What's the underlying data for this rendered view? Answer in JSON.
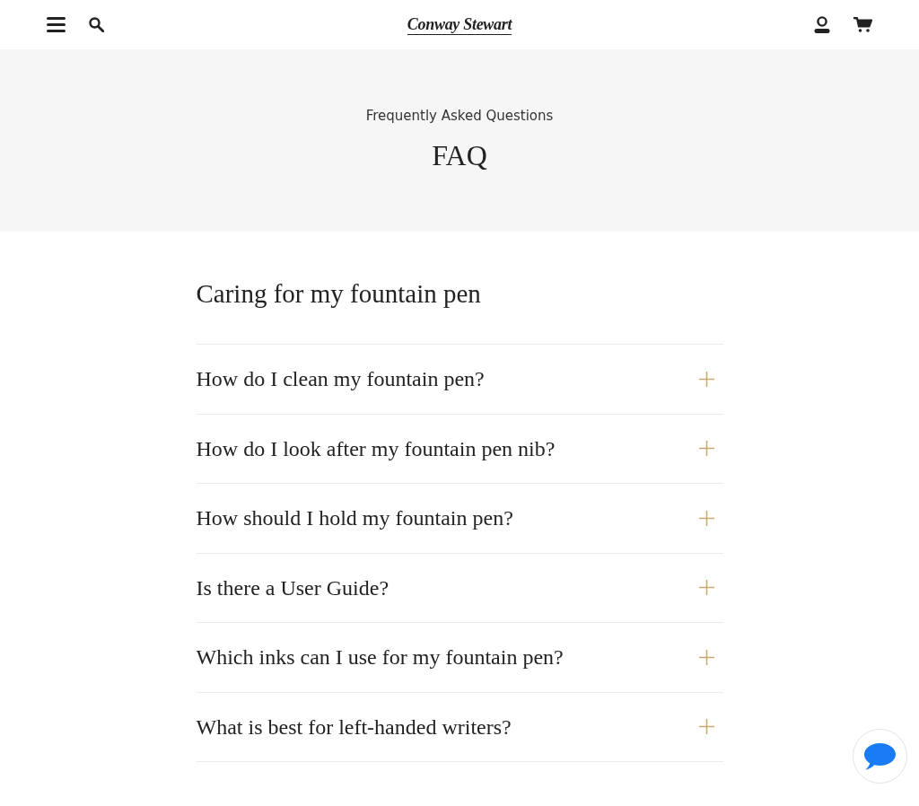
{
  "header": {
    "logo": "Conway Stewart"
  },
  "hero": {
    "subtitle": "Frequently Asked Questions",
    "title": "FAQ"
  },
  "faq_section": {
    "heading": "Caring for my fountain pen",
    "items": [
      {
        "question": "How do I clean my fountain pen?",
        "expanded": false
      },
      {
        "question": "How do I look after my fountain pen nib?",
        "expanded": false
      },
      {
        "question": "How should I hold my fountain pen?",
        "expanded": false
      },
      {
        "question": "Is there a User Guide?",
        "expanded": false
      },
      {
        "question": "Which inks can I use for my fountain pen?",
        "expanded": false
      },
      {
        "question": "What is best for left-handed writers?",
        "expanded": false
      }
    ]
  }
}
